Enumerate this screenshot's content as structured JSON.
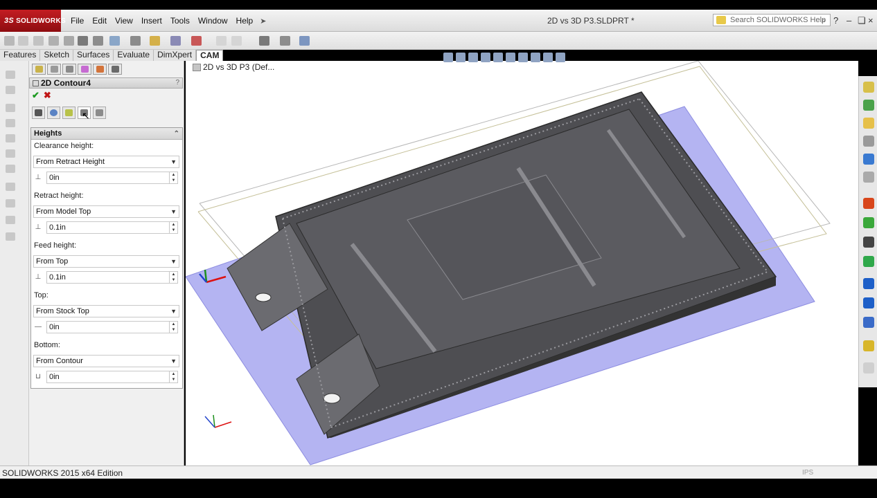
{
  "app": {
    "logo": "SOLIDWORKS",
    "logo_mark": "3S",
    "document_title": "2D vs 3D P3.SLDPRT *",
    "search_placeholder": "Search SOLIDWORKS Help"
  },
  "menu": [
    "File",
    "Edit",
    "View",
    "Insert",
    "Tools",
    "Window",
    "Help"
  ],
  "command_tabs": [
    {
      "label": "Features",
      "active": false
    },
    {
      "label": "Sketch",
      "active": false
    },
    {
      "label": "Surfaces",
      "active": false
    },
    {
      "label": "Evaluate",
      "active": false
    },
    {
      "label": "DimXpert",
      "active": false
    },
    {
      "label": "CAM",
      "active": true
    }
  ],
  "property_manager": {
    "feature_name": "2D Contour4",
    "help_mark": "?",
    "section_title": "Heights",
    "fields": [
      {
        "label": "Clearance height:",
        "option": "From Retract Height",
        "value": "0in"
      },
      {
        "label": "Retract height:",
        "option": "From Model Top",
        "value": "0.1in"
      },
      {
        "label": "Feed height:",
        "option": "From Top",
        "value": "0.1in"
      },
      {
        "label": "Top:",
        "option": "From Stock Top",
        "value": "0in"
      },
      {
        "label": "Bottom:",
        "option": "From Contour",
        "value": "0in"
      }
    ]
  },
  "viewport": {
    "tree_breadcrumb": "2D vs 3D P3   (Def..."
  },
  "status": {
    "text": "SOLIDWORKS 2015 x64 Edition",
    "right": "IPS"
  },
  "colors": {
    "stock_plane": "#b4b4f2",
    "part_body": "#4e4e52",
    "logo_red": "#c31d22"
  }
}
